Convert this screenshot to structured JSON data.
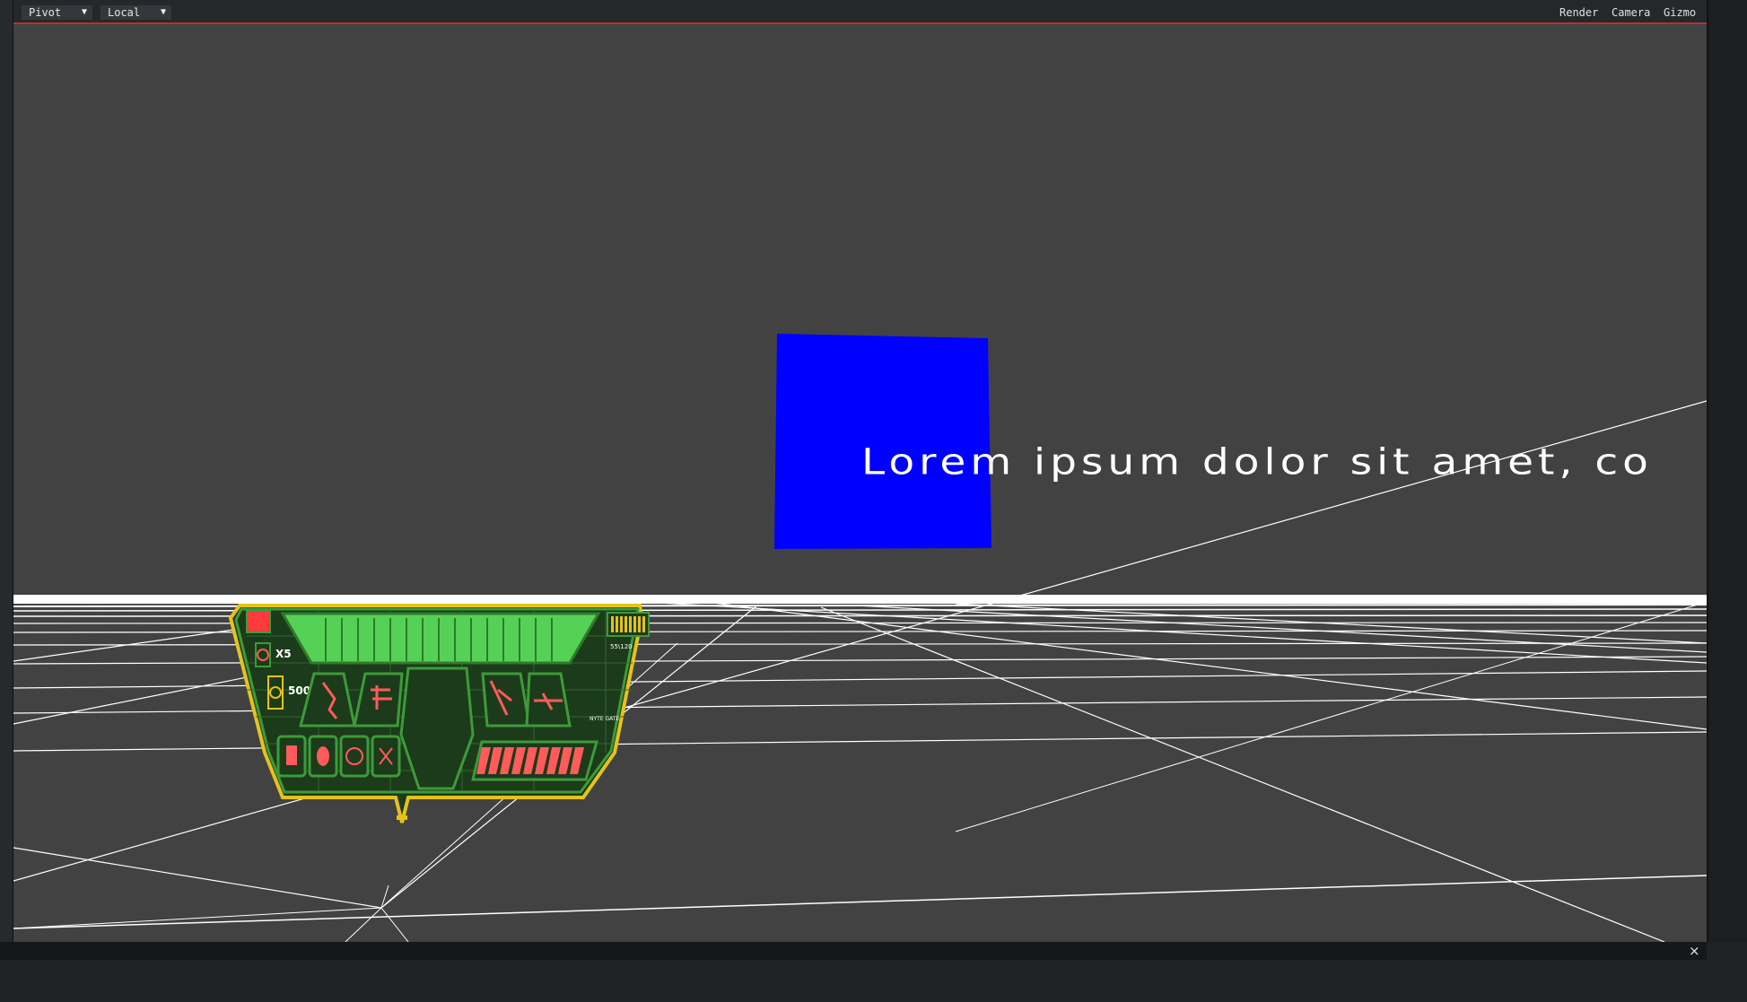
{
  "toolbar": {
    "pivot_label": "Pivot",
    "local_label": "Local",
    "dropdown_arrow": "▼",
    "menu": [
      "Render",
      "Camera",
      "Gizmo"
    ]
  },
  "scene": {
    "lorem_text": "Lorem ipsum dolor sit amet, co",
    "cube_color": "#0000ff",
    "grid_color": "#ffffff",
    "background_color": "#424242"
  },
  "hud": {
    "lives_label": "X5",
    "score_label": "5000",
    "top_right_small": "55\\120",
    "mid_right_small": "NYTE GATE",
    "frame_color": "#e6c21c",
    "panel_color": "#1c3b1a",
    "bar_color": "#55d155",
    "red_color": "#ff5b5b",
    "green_bar_segments": 16,
    "red_bar_segments": 9,
    "yellow_segments": 8
  },
  "status": {
    "close_symbol": "×"
  }
}
